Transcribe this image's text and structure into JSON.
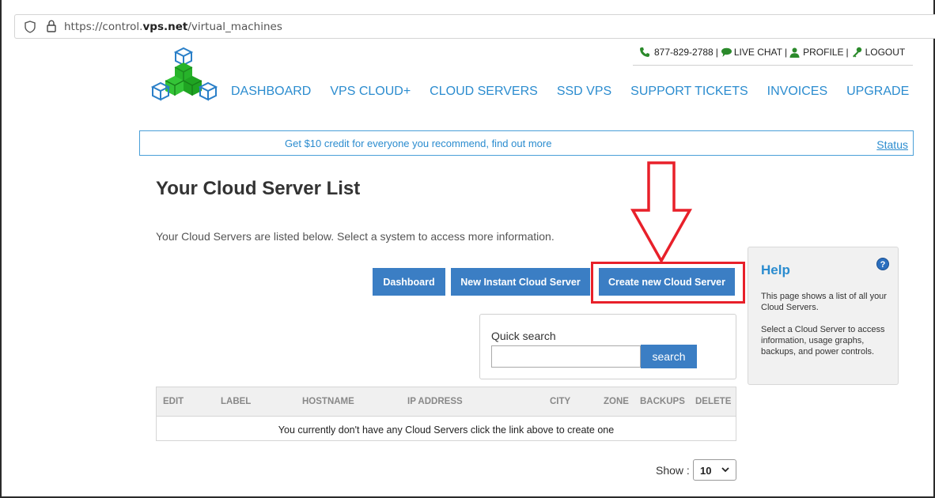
{
  "browser": {
    "url_prefix": "https://control.",
    "url_domain": "vps.net",
    "url_path": "/virtual_machines"
  },
  "header": {
    "phone": "877-829-2788",
    "live_chat": "LIVE CHAT",
    "profile": "PROFILE",
    "logout": "LOGOUT",
    "separator": "|"
  },
  "nav": {
    "items": [
      "DASHBOARD",
      "VPS CLOUD+",
      "CLOUD SERVERS",
      "SSD VPS",
      "SUPPORT TICKETS",
      "INVOICES",
      "UPGRADE"
    ]
  },
  "promo": {
    "message": "Get $10 credit for everyone you recommend, find out more",
    "status_link": "Status"
  },
  "page": {
    "title": "Your Cloud Server List",
    "subtitle": "Your Cloud Servers are listed below. Select a system to access more information."
  },
  "actions": {
    "dashboard": "Dashboard",
    "new_instant": "New Instant Cloud Server",
    "create_new": "Create new Cloud Server"
  },
  "search": {
    "label": "Quick search",
    "value": "",
    "button": "search"
  },
  "help": {
    "title": "Help",
    "icon": "?",
    "para1": "This page shows a list of all your Cloud Servers.",
    "para2": "Select a Cloud Server to access information, usage graphs, backups, and power controls."
  },
  "table": {
    "columns": [
      "EDIT",
      "LABEL",
      "HOSTNAME",
      "IP ADDRESS",
      "CITY",
      "ZONE",
      "BACKUPS",
      "DELETE"
    ],
    "empty_message": "You currently don't have any Cloud Servers click the link above to create one"
  },
  "pagination": {
    "show_label": "Show :",
    "show_value": "10"
  },
  "colors": {
    "link": "#2b8ccf",
    "button": "#3b7ec4",
    "highlight": "#e8202a",
    "logo_green": "#27b32a",
    "logo_blue": "#2a7fc8"
  },
  "icons": [
    "shield-icon",
    "lock-icon",
    "phone-icon",
    "chat-icon",
    "user-icon",
    "key-icon",
    "help-icon",
    "chevron-down-icon",
    "down-arrow-annotation"
  ]
}
